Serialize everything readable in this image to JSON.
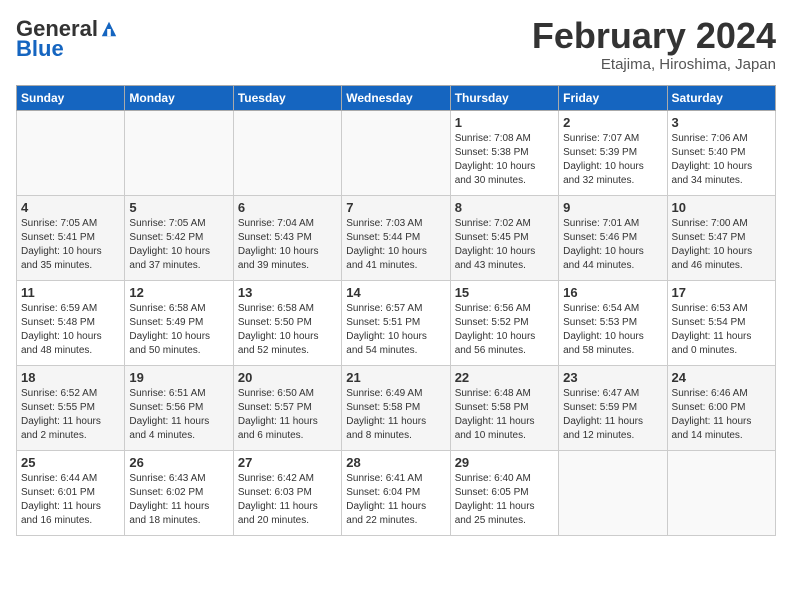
{
  "header": {
    "logo_general": "General",
    "logo_blue": "Blue",
    "title": "February 2024",
    "subtitle": "Etajima, Hiroshima, Japan"
  },
  "weekdays": [
    "Sunday",
    "Monday",
    "Tuesday",
    "Wednesday",
    "Thursday",
    "Friday",
    "Saturday"
  ],
  "weeks": [
    [
      {
        "day": "",
        "info": ""
      },
      {
        "day": "",
        "info": ""
      },
      {
        "day": "",
        "info": ""
      },
      {
        "day": "",
        "info": ""
      },
      {
        "day": "1",
        "info": "Sunrise: 7:08 AM\nSunset: 5:38 PM\nDaylight: 10 hours\nand 30 minutes."
      },
      {
        "day": "2",
        "info": "Sunrise: 7:07 AM\nSunset: 5:39 PM\nDaylight: 10 hours\nand 32 minutes."
      },
      {
        "day": "3",
        "info": "Sunrise: 7:06 AM\nSunset: 5:40 PM\nDaylight: 10 hours\nand 34 minutes."
      }
    ],
    [
      {
        "day": "4",
        "info": "Sunrise: 7:05 AM\nSunset: 5:41 PM\nDaylight: 10 hours\nand 35 minutes."
      },
      {
        "day": "5",
        "info": "Sunrise: 7:05 AM\nSunset: 5:42 PM\nDaylight: 10 hours\nand 37 minutes."
      },
      {
        "day": "6",
        "info": "Sunrise: 7:04 AM\nSunset: 5:43 PM\nDaylight: 10 hours\nand 39 minutes."
      },
      {
        "day": "7",
        "info": "Sunrise: 7:03 AM\nSunset: 5:44 PM\nDaylight: 10 hours\nand 41 minutes."
      },
      {
        "day": "8",
        "info": "Sunrise: 7:02 AM\nSunset: 5:45 PM\nDaylight: 10 hours\nand 43 minutes."
      },
      {
        "day": "9",
        "info": "Sunrise: 7:01 AM\nSunset: 5:46 PM\nDaylight: 10 hours\nand 44 minutes."
      },
      {
        "day": "10",
        "info": "Sunrise: 7:00 AM\nSunset: 5:47 PM\nDaylight: 10 hours\nand 46 minutes."
      }
    ],
    [
      {
        "day": "11",
        "info": "Sunrise: 6:59 AM\nSunset: 5:48 PM\nDaylight: 10 hours\nand 48 minutes."
      },
      {
        "day": "12",
        "info": "Sunrise: 6:58 AM\nSunset: 5:49 PM\nDaylight: 10 hours\nand 50 minutes."
      },
      {
        "day": "13",
        "info": "Sunrise: 6:58 AM\nSunset: 5:50 PM\nDaylight: 10 hours\nand 52 minutes."
      },
      {
        "day": "14",
        "info": "Sunrise: 6:57 AM\nSunset: 5:51 PM\nDaylight: 10 hours\nand 54 minutes."
      },
      {
        "day": "15",
        "info": "Sunrise: 6:56 AM\nSunset: 5:52 PM\nDaylight: 10 hours\nand 56 minutes."
      },
      {
        "day": "16",
        "info": "Sunrise: 6:54 AM\nSunset: 5:53 PM\nDaylight: 10 hours\nand 58 minutes."
      },
      {
        "day": "17",
        "info": "Sunrise: 6:53 AM\nSunset: 5:54 PM\nDaylight: 11 hours\nand 0 minutes."
      }
    ],
    [
      {
        "day": "18",
        "info": "Sunrise: 6:52 AM\nSunset: 5:55 PM\nDaylight: 11 hours\nand 2 minutes."
      },
      {
        "day": "19",
        "info": "Sunrise: 6:51 AM\nSunset: 5:56 PM\nDaylight: 11 hours\nand 4 minutes."
      },
      {
        "day": "20",
        "info": "Sunrise: 6:50 AM\nSunset: 5:57 PM\nDaylight: 11 hours\nand 6 minutes."
      },
      {
        "day": "21",
        "info": "Sunrise: 6:49 AM\nSunset: 5:58 PM\nDaylight: 11 hours\nand 8 minutes."
      },
      {
        "day": "22",
        "info": "Sunrise: 6:48 AM\nSunset: 5:58 PM\nDaylight: 11 hours\nand 10 minutes."
      },
      {
        "day": "23",
        "info": "Sunrise: 6:47 AM\nSunset: 5:59 PM\nDaylight: 11 hours\nand 12 minutes."
      },
      {
        "day": "24",
        "info": "Sunrise: 6:46 AM\nSunset: 6:00 PM\nDaylight: 11 hours\nand 14 minutes."
      }
    ],
    [
      {
        "day": "25",
        "info": "Sunrise: 6:44 AM\nSunset: 6:01 PM\nDaylight: 11 hours\nand 16 minutes."
      },
      {
        "day": "26",
        "info": "Sunrise: 6:43 AM\nSunset: 6:02 PM\nDaylight: 11 hours\nand 18 minutes."
      },
      {
        "day": "27",
        "info": "Sunrise: 6:42 AM\nSunset: 6:03 PM\nDaylight: 11 hours\nand 20 minutes."
      },
      {
        "day": "28",
        "info": "Sunrise: 6:41 AM\nSunset: 6:04 PM\nDaylight: 11 hours\nand 22 minutes."
      },
      {
        "day": "29",
        "info": "Sunrise: 6:40 AM\nSunset: 6:05 PM\nDaylight: 11 hours\nand 25 minutes."
      },
      {
        "day": "",
        "info": ""
      },
      {
        "day": "",
        "info": ""
      }
    ]
  ]
}
